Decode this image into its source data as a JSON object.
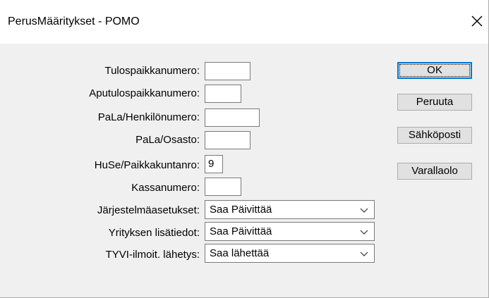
{
  "window": {
    "title": "PerusMääritykset - POMO"
  },
  "fields": [
    {
      "label": "Tulospaikkanumero:",
      "value": ""
    },
    {
      "label": "Aputulospaikkanumero:",
      "value": ""
    },
    {
      "label": "PaLa/Henkilönumero:",
      "value": ""
    },
    {
      "label": "PaLa/Osasto:",
      "value": ""
    },
    {
      "label": "HuSe/Paikkakuntanro:",
      "value": "9"
    },
    {
      "label": "Kassanumero:",
      "value": ""
    }
  ],
  "selects": [
    {
      "label": "Järjestelmäasetukset:",
      "value": "Saa Päivittää"
    },
    {
      "label": "Yrityksen lisätiedot:",
      "value": "Saa Päivittää"
    },
    {
      "label": "TYVI-ilmoit. lähetys:",
      "value": "Saa lähettää"
    }
  ],
  "buttons": {
    "ok": "OK",
    "cancel": "Peruuta",
    "email": "Sähköposti",
    "backup": "Varallaolo"
  },
  "icons": {
    "close": "close-icon",
    "dropdown": "chevron-down-icon"
  },
  "colors": {
    "default_button_border": "#0078d7",
    "dialog_bg": "#f0f0f0"
  }
}
